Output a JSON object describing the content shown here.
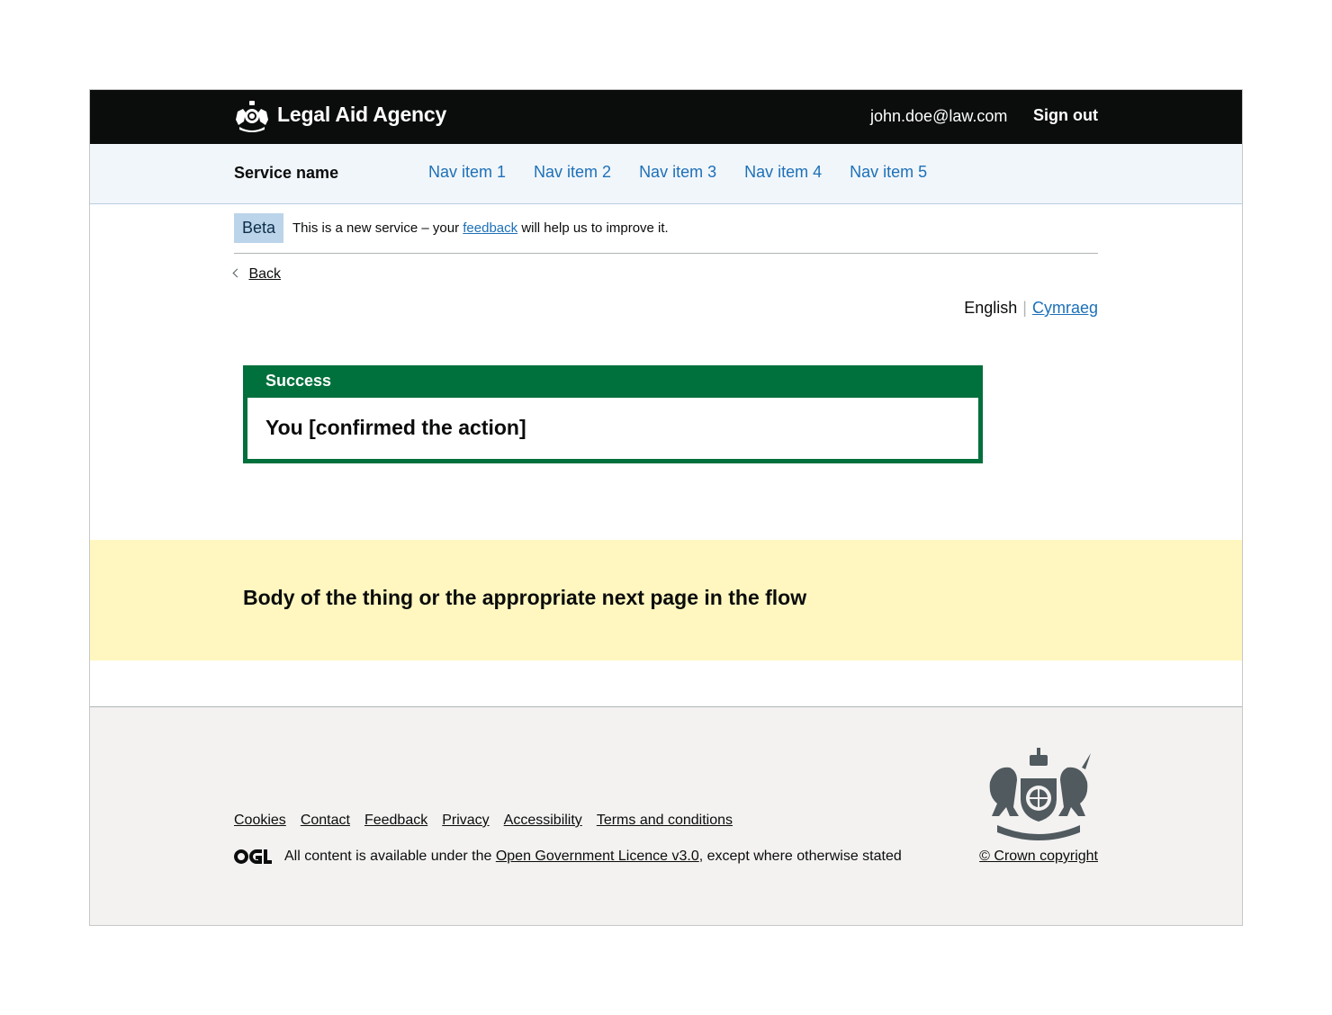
{
  "header": {
    "agency_name": "Legal Aid Agency",
    "user_email": "john.doe@law.com",
    "sign_out_label": "Sign out"
  },
  "service_nav": {
    "service_name": "Service name",
    "items": [
      "Nav item 1",
      "Nav item 2",
      "Nav item 3",
      "Nav item 4",
      "Nav item 5"
    ]
  },
  "phase_banner": {
    "tag": "Beta",
    "text_before": "This is a new service – your",
    "link": "feedback",
    "text_after": "will help us to improve it."
  },
  "back_link": "Back",
  "language": {
    "current": "English",
    "other": "Cymraeg"
  },
  "notification": {
    "title": "Success",
    "message": "You [confirmed the action]"
  },
  "placeholder_body": "Body of the thing or the appropriate next page in the flow",
  "footer": {
    "links": [
      "Cookies",
      "Contact",
      "Feedback",
      "Privacy",
      "Accessibility",
      "Terms and conditions"
    ],
    "licence_before": "All content is available under the",
    "licence_link": "Open Government Licence v3.0",
    "licence_after": ", except where otherwise stated",
    "copyright": "© Crown copyright"
  },
  "colors": {
    "header_bg": "#0b0c0c",
    "link": "#1d70b8",
    "success": "#00703c",
    "placeholder_bg": "#fff7bf",
    "footer_bg": "#f3f2f1"
  }
}
